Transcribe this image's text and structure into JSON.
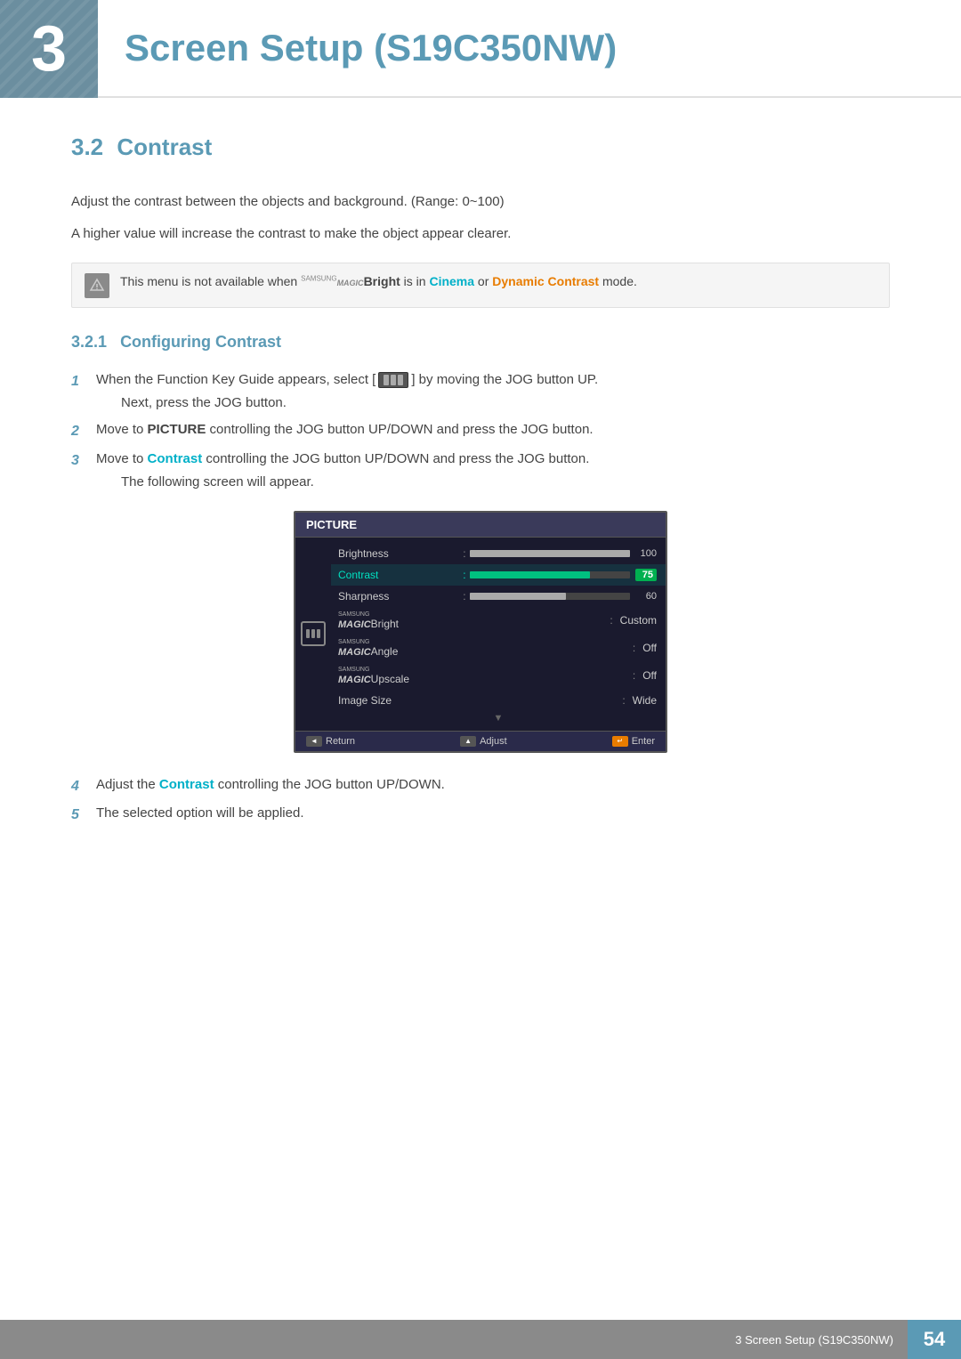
{
  "header": {
    "chapter_number": "3",
    "title": "Screen Setup (S19C350NW)"
  },
  "section": {
    "number": "3.2",
    "title": "Contrast",
    "description1": "Adjust the contrast between the objects and background. (Range: 0~100)",
    "description2": "A higher value will increase the contrast to make the object appear clearer.",
    "note": "This menu is not available when ",
    "note_brand": "SAMSUNG",
    "note_magic": "MAGIC",
    "note_bright": "Bright",
    "note_mid": " is in ",
    "note_cinema": "Cinema",
    "note_or": " or ",
    "note_dynamic": "Dynamic Contrast",
    "note_end": " mode.",
    "subsection": {
      "number": "3.2.1",
      "title": "Configuring Contrast",
      "steps": [
        {
          "num": "1",
          "text": "When the Function Key Guide appears, select [",
          "icon": true,
          "text2": "] by moving the JOG button UP.",
          "sub": "Next, press the JOG button."
        },
        {
          "num": "2",
          "text": "Move to ",
          "bold": "PICTURE",
          "text2": " controlling the JOG button UP/DOWN and press the JOG button.",
          "sub": ""
        },
        {
          "num": "3",
          "text": "Move to ",
          "bold": "Contrast",
          "bold_color": "cyan",
          "text2": " controlling the JOG button UP/DOWN and press the JOG button.",
          "sub": "The following screen will appear."
        },
        {
          "num": "4",
          "text": "Adjust the ",
          "bold": "Contrast",
          "bold_color": "cyan",
          "text2": " controlling the JOG button UP/DOWN.",
          "sub": ""
        },
        {
          "num": "5",
          "text": "The selected option will be applied.",
          "sub": ""
        }
      ]
    }
  },
  "osd": {
    "title": "PICTURE",
    "rows": [
      {
        "label": "Brightness",
        "type": "bar",
        "fill": "brightness",
        "value": "100",
        "active": false
      },
      {
        "label": "Contrast",
        "type": "bar",
        "fill": "contrast",
        "value": "75",
        "active": true
      },
      {
        "label": "Sharpness",
        "type": "bar",
        "fill": "sharpness",
        "value": "60",
        "active": false
      },
      {
        "label": "MAGIC Bright",
        "type": "text",
        "value": "Custom",
        "active": false
      },
      {
        "label": "MAGIC Angle",
        "type": "text",
        "value": "Off",
        "active": false
      },
      {
        "label": "MAGIC Upscale",
        "type": "text",
        "value": "Off",
        "active": false
      },
      {
        "label": "Image Size",
        "type": "text",
        "value": "Wide",
        "active": false
      }
    ],
    "footer": {
      "return": "Return",
      "adjust": "Adjust",
      "enter": "Enter"
    }
  },
  "footer": {
    "text": "3 Screen Setup (S19C350NW)",
    "page": "54"
  }
}
